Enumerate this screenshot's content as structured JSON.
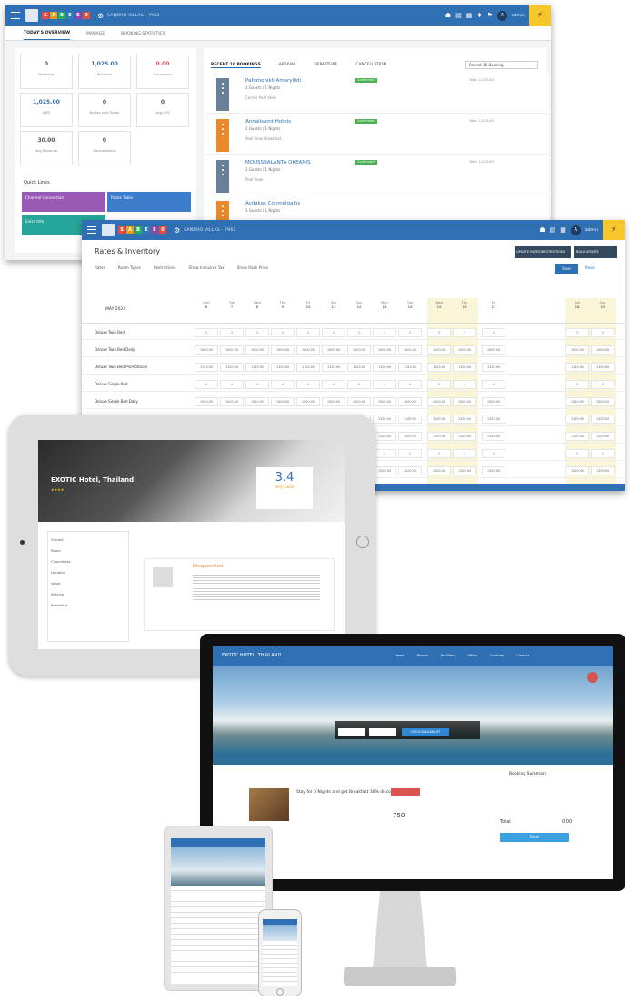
{
  "w1": {
    "tabs": [
      "TODAY'S OVERVIEW",
      "MANAGE",
      "BOOKING STATISTICS"
    ],
    "hotel": "SANDRO VILLAS - 7962",
    "user": "admin",
    "kpis": [
      {
        "v": "0",
        "l": "Bookings"
      },
      {
        "v": "1,025.00",
        "l": "Revenue"
      },
      {
        "v": "0.00",
        "l": "Occupancy"
      },
      {
        "v": "1,025.00",
        "l": "ADR"
      },
      {
        "v": "0",
        "l": "Nights sold Today"
      },
      {
        "v": "0",
        "l": "Avg LOS"
      },
      {
        "v": "30.00",
        "l": "Avg Revenue"
      },
      {
        "v": "0",
        "l": "Cancellations"
      }
    ],
    "quick_links_title": "Quick Links",
    "quick_links": [
      "Channel Connection",
      "Rates Table",
      "Extra Info"
    ],
    "booking_tabs": [
      "RECENT 10 BOOKINGS",
      "ARRIVAL",
      "DEPARTURE",
      "CANCELLATION"
    ],
    "sort_label": "Recent 10 Booking",
    "bookings": [
      {
        "name": "Pafomonikli Amaryllidi",
        "sub": "2 Guests / 1 Nights",
        "room": "Corner Pool View",
        "status": "Confirmed",
        "total": "Total: 1,025.00",
        "color": "#6a7f98"
      },
      {
        "name": "Annalisamt Hotels",
        "sub": "2 Guests / 1 Nights",
        "room": "Pool View Breakfast",
        "status": "Confirmed",
        "total": "Total: 1,025.00",
        "color": "#e88a2b"
      },
      {
        "name": "MOUSSBALANTA OKEANIS",
        "sub": "2 Guests / 1 Nights",
        "room": "Pool View",
        "status": "Confirmed",
        "total": "Total: 1,025.00",
        "color": "#6a7f98"
      },
      {
        "name": "Avdakas Conmelgalos",
        "sub": "2 Guests / 1 Nights",
        "room": "Pool View",
        "status": "Confirmed",
        "total": "Total: 1,025.00",
        "color": "#e88a2b"
      }
    ]
  },
  "w2": {
    "title": "Rates & Inventory",
    "toolbar_right": [
      "UPDATE RATES/RESTRICTIONS",
      "BULK UPDATE"
    ],
    "save": "Save",
    "reset": "Reset",
    "filters": [
      "Rates",
      "Room Types",
      "Restrictions",
      "Show Inclusive Tax",
      "Show Rack Price"
    ],
    "month": "MAY 2024",
    "days": [
      {
        "d": "Mon",
        "n": "6"
      },
      {
        "d": "Tue",
        "n": "7"
      },
      {
        "d": "Wed",
        "n": "8"
      },
      {
        "d": "Thu",
        "n": "9"
      },
      {
        "d": "Fri",
        "n": "10"
      },
      {
        "d": "Sat",
        "n": "11"
      },
      {
        "d": "Sun",
        "n": "12"
      },
      {
        "d": "Mon",
        "n": "13"
      },
      {
        "d": "Tue",
        "n": "14"
      },
      {
        "d": "Wed",
        "n": "15"
      },
      {
        "d": "Thu",
        "n": "16"
      },
      {
        "d": "Fri",
        "n": "17"
      },
      {
        "d": "Sat",
        "n": "18"
      },
      {
        "d": "Sun",
        "n": "19"
      }
    ],
    "rows": [
      {
        "label": "Deluxe Twin Bed",
        "val": "2"
      },
      {
        "label": "Deluxe Twin Bed Daily",
        "val": "1000.00"
      },
      {
        "label": "Deluxe Twin Bed Promotional",
        "val": "1100.00"
      },
      {
        "label": "Deluxe Single Bed",
        "val": "4"
      },
      {
        "label": "Deluxe Single Bed Daily",
        "val": "1000.00"
      },
      {
        "label": "Deluxe Single Bed Promotional",
        "val": "1100.00"
      },
      {
        "label": "SUITE DOUBLE 1 Adult",
        "val": "1100.00"
      },
      {
        "label": "",
        "val": "1"
      },
      {
        "label": "",
        "val": "1200.00"
      }
    ]
  },
  "tablet": {
    "hotel": "EXOTIC Hotel, Thailand",
    "score": "3.4",
    "score_label": "Very Good",
    "review_title": "Disappointed",
    "filters": [
      "Overall",
      "Room",
      "Cleanliness",
      "Location",
      "Value",
      "Service",
      "Breakfast"
    ]
  },
  "monitor": {
    "site_title": "EXOTIC HOTEL, THAILAND",
    "nav": [
      "Home",
      "Rooms",
      "Facilities",
      "Offers",
      "Location",
      "Contact"
    ],
    "search_btn": "CHECK AVAILABILITY",
    "room_title": "Stay for 3 Nights and get Breakfast 30% discount",
    "price": "750",
    "book": "BOOK NOW",
    "cart_title": "Booking Summary",
    "total_label": "Total",
    "total": "0.00",
    "confirm": "Book"
  }
}
